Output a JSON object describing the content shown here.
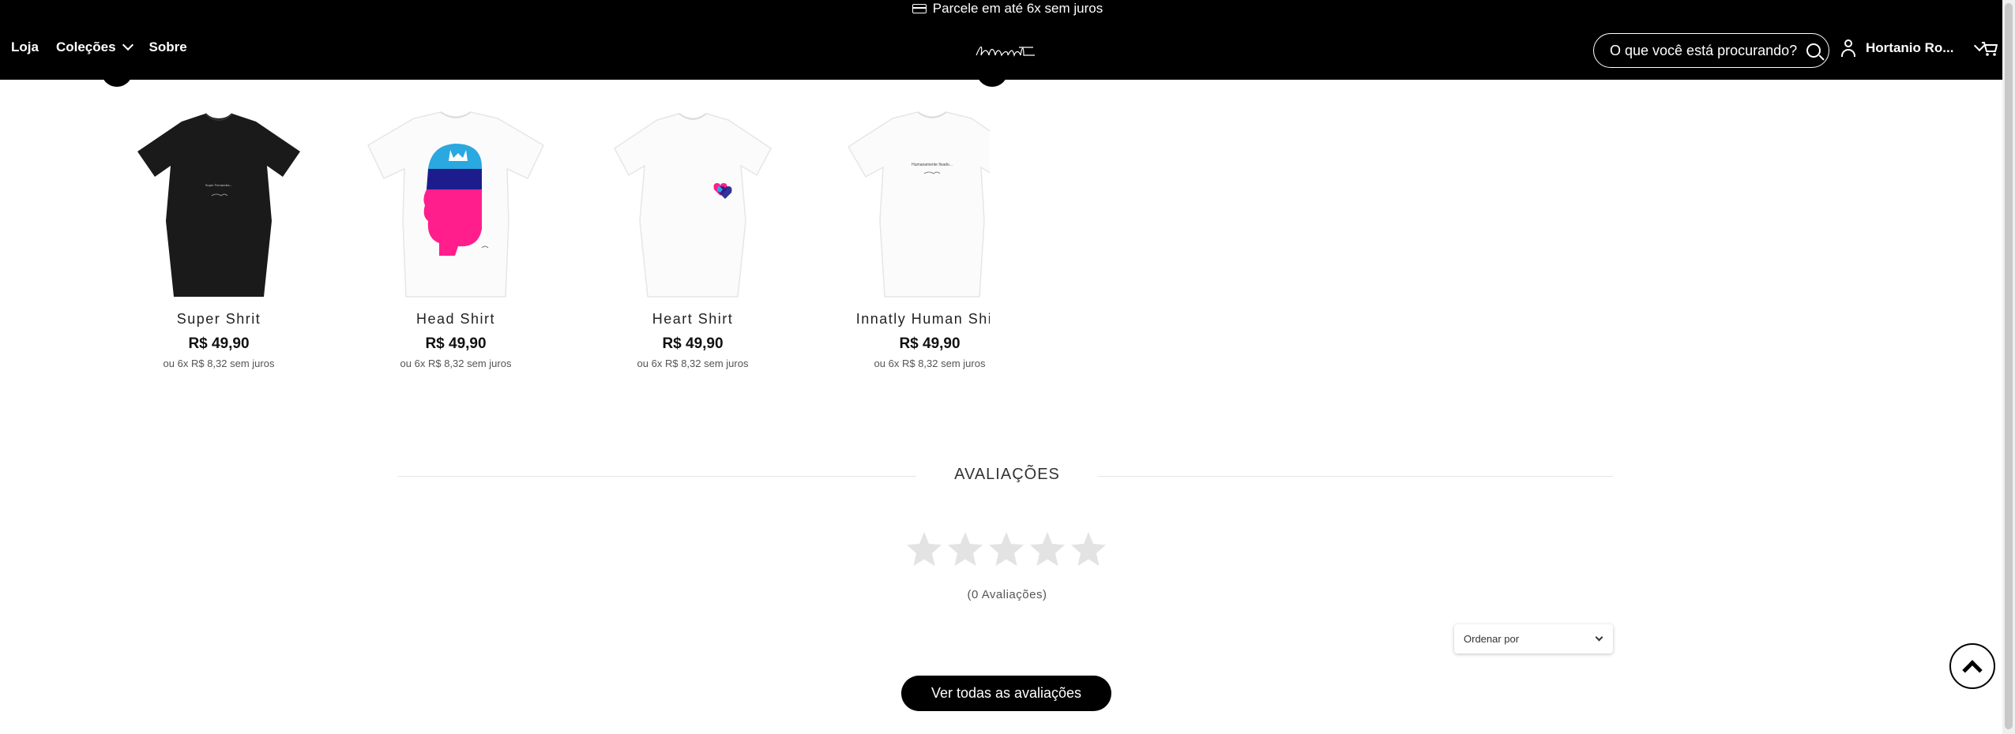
{
  "promo": {
    "text": "Parcele em até 6x sem juros",
    "icon": "credit-card-icon"
  },
  "nav": {
    "loja": "Loja",
    "colecoes": "Coleções",
    "sobre": "Sobre"
  },
  "logo_alt": "lebsit",
  "search": {
    "placeholder": "O que você está procurando?"
  },
  "user": {
    "name": "Hortanio Ro..."
  },
  "products": [
    {
      "name": "Super Shrit",
      "price": "R$ 49,90",
      "installments": "ou 6x R$ 8,32 sem juros",
      "color": "#1a1a1a",
      "print": "Super Fernandes..."
    },
    {
      "name": "Head Shirt",
      "price": "R$ 49,90",
      "installments": "ou 6x R$ 8,32 sem juros",
      "color": "#ffffff"
    },
    {
      "name": "Heart Shirt",
      "price": "R$ 49,90",
      "installments": "ou 6x R$ 8,32 sem juros",
      "color": "#ffffff"
    },
    {
      "name": "Innatly Human Shirt",
      "price": "R$ 49,90",
      "installments": "ou 6x R$ 8,32 sem juros",
      "color": "#ffffff",
      "print": "Humanamente fixado..."
    }
  ],
  "reviews": {
    "title": "AVALIAÇÕES",
    "rating": 0,
    "max_rating": 5,
    "count_text": "(0 Avaliações)",
    "sort_label": "Ordenar por",
    "view_all": "Ver todas as avaliações"
  },
  "colors": {
    "header_bg": "#000000",
    "star_empty": "#e3e3e3",
    "head_pink": "#ff1e8c",
    "head_blue": "#2aa8e0",
    "head_navy": "#1c1c8c"
  }
}
